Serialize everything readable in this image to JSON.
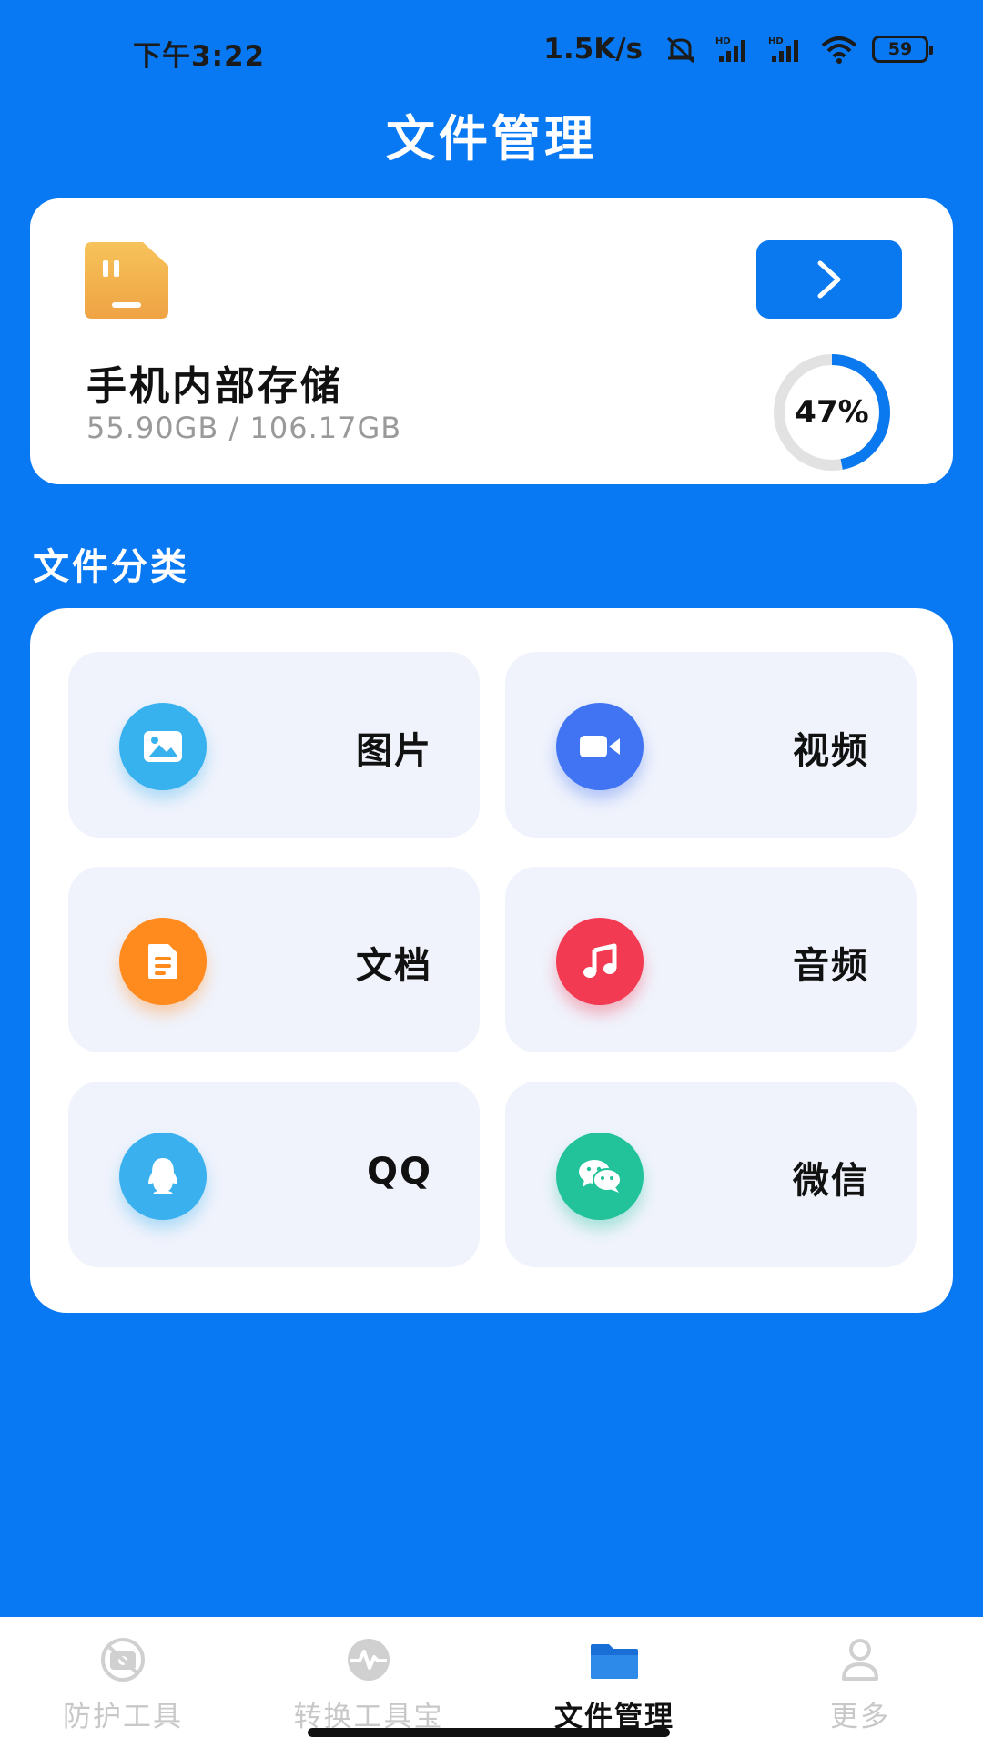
{
  "status_bar": {
    "time": "下午3:22",
    "network_speed": "1.5K/s",
    "battery": "59"
  },
  "header": {
    "title": "文件管理"
  },
  "storage": {
    "name": "手机内部存储",
    "usage": "55.90GB / 106.17GB",
    "percent_label": "47%",
    "percent": 47,
    "icon": "sd-card-icon",
    "open_icon": "chevron-right-icon"
  },
  "categories": {
    "title": "文件分类",
    "items": [
      {
        "label": "图片",
        "icon": "image-icon",
        "color": "#38B2EE"
      },
      {
        "label": "视频",
        "icon": "video-camera-icon",
        "color": "#4174F2"
      },
      {
        "label": "文档",
        "icon": "document-icon",
        "color": "#FF8A1E"
      },
      {
        "label": "音频",
        "icon": "music-note-icon",
        "color": "#F23A52"
      },
      {
        "label": "QQ",
        "icon": "qq-penguin-icon",
        "color": "#3AB1EE"
      },
      {
        "label": "微信",
        "icon": "wechat-icon",
        "color": "#22C29A"
      }
    ]
  },
  "bottom_nav": {
    "items": [
      {
        "label": "防护工具",
        "icon": "camera-block-icon",
        "active": false
      },
      {
        "label": "转换工具宝",
        "icon": "pulse-icon",
        "active": false
      },
      {
        "label": "文件管理",
        "icon": "folder-icon",
        "active": true
      },
      {
        "label": "更多",
        "icon": "person-icon",
        "active": false
      }
    ]
  },
  "colors": {
    "background": "#0879F2",
    "accent": "#0A79F0",
    "tile": "#F0F3FC"
  }
}
